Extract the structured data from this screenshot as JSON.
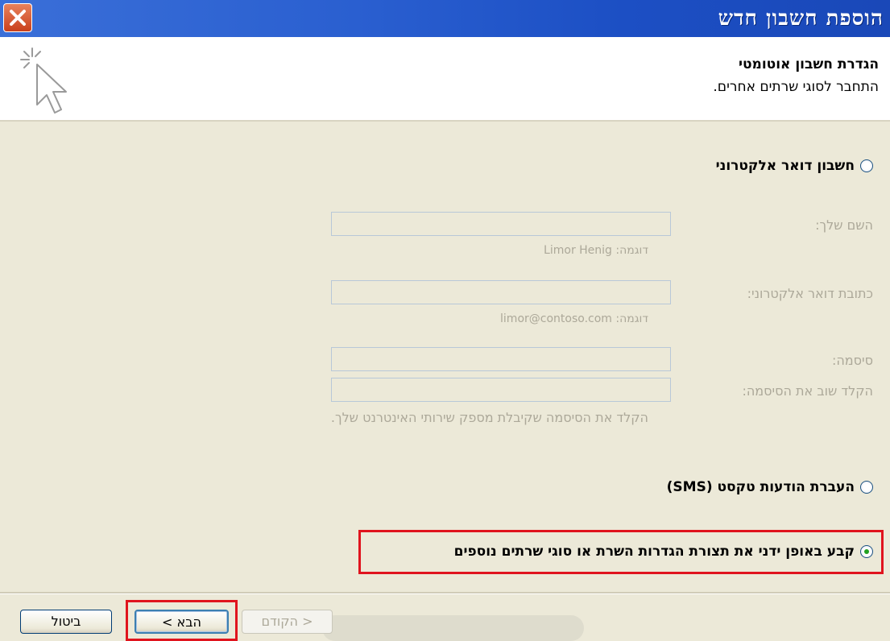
{
  "window": {
    "title": "הוספת חשבון חדש"
  },
  "header": {
    "title": "הגדרת חשבון אוטומטי",
    "subtitle": "התחבר לסוגי שרתים אחרים."
  },
  "options": {
    "email": "חשבון דואר אלקטרוני",
    "sms": "העברת הודעות טקסט (SMS)",
    "manual": "קבע באופן ידני את תצורת הגדרות השרת או סוגי שרתים נוספים"
  },
  "form": {
    "name_label": "השם שלך:",
    "name_hint": "דוגמה: Limor Henig",
    "email_label": "כתובת דואר אלקטרוני:",
    "email_hint": "דוגמה: limor@contoso.com",
    "password_label": "סיסמה:",
    "retype_label": "הקלד שוב את הסיסמה:",
    "password_hint": "הקלד את הסיסמה שקיבלת מספק שירותי האינטרנט שלך."
  },
  "buttons": {
    "cancel": "ביטול",
    "next": "הבא >",
    "back": "< הקודם"
  }
}
